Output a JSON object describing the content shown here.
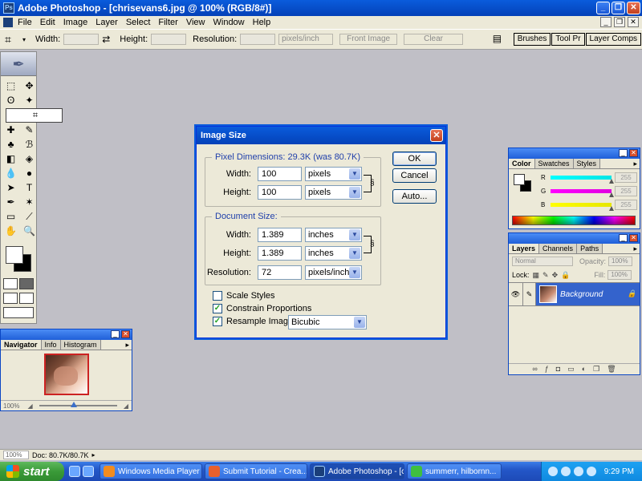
{
  "window": {
    "title": "Adobe Photoshop - [chrisevans6.jpg @ 100% (RGB/8#)]"
  },
  "menu": [
    "File",
    "Edit",
    "Image",
    "Layer",
    "Select",
    "Filter",
    "View",
    "Window",
    "Help"
  ],
  "options": {
    "width_label": "Width:",
    "height_label": "Height:",
    "resolution_label": "Resolution:",
    "units": "pixels/inch",
    "front_image": "Front Image",
    "clear": "Clear"
  },
  "palette_well": [
    "Brushes",
    "Tool Pr",
    "Layer Comps"
  ],
  "dialog": {
    "title": "Image Size",
    "pixel_dimensions_label": "Pixel Dimensions:",
    "pixel_dimensions_value": "29.3K (was 80.7K)",
    "pixel": {
      "width_label": "Width:",
      "width_value": "100",
      "width_unit": "pixels",
      "height_label": "Height:",
      "height_value": "100",
      "height_unit": "pixels"
    },
    "document_size_label": "Document Size:",
    "doc": {
      "width_label": "Width:",
      "width_value": "1.389",
      "width_unit": "inches",
      "height_label": "Height:",
      "height_value": "1.389",
      "height_unit": "inches",
      "resolution_label": "Resolution:",
      "resolution_value": "72",
      "resolution_unit": "pixels/inch"
    },
    "buttons": {
      "ok": "OK",
      "cancel": "Cancel",
      "auto": "Auto..."
    },
    "checks": {
      "scale_styles": "Scale Styles",
      "constrain": "Constrain Proportions",
      "resample": "Resample Image:",
      "resample_method": "Bicubic"
    }
  },
  "navigator": {
    "tabs": [
      "Navigator",
      "Info",
      "Histogram"
    ],
    "zoom": "100%"
  },
  "color_panel": {
    "tabs": [
      "Color",
      "Swatches",
      "Styles"
    ],
    "channels": [
      {
        "label": "R",
        "value": "255",
        "color": "#00e5e5"
      },
      {
        "label": "G",
        "value": "255",
        "color": "#e000e0"
      },
      {
        "label": "B",
        "value": "255",
        "color": "#e6e600"
      }
    ]
  },
  "layers_panel": {
    "tabs": [
      "Layers",
      "Channels",
      "Paths"
    ],
    "blend_mode": "Normal",
    "opacity_label": "Opacity:",
    "opacity_value": "100%",
    "lock_label": "Lock:",
    "fill_label": "Fill:",
    "fill_value": "100%",
    "layer_name": "Background"
  },
  "status": {
    "zoom": "100%",
    "doc": "Doc: 80.7K/80.7K"
  },
  "taskbar": {
    "start": "start",
    "items": [
      {
        "label": "Windows Media Player",
        "color": "#f28c1f"
      },
      {
        "label": "Submit Tutorial - Crea...",
        "color": "#e8602c"
      },
      {
        "label": "Adobe Photoshop - [c...",
        "color": "#1b3f7a"
      },
      {
        "label": "summerr, hilbornn...",
        "color": "#3fbf3f"
      }
    ],
    "time": "9:29 PM"
  }
}
